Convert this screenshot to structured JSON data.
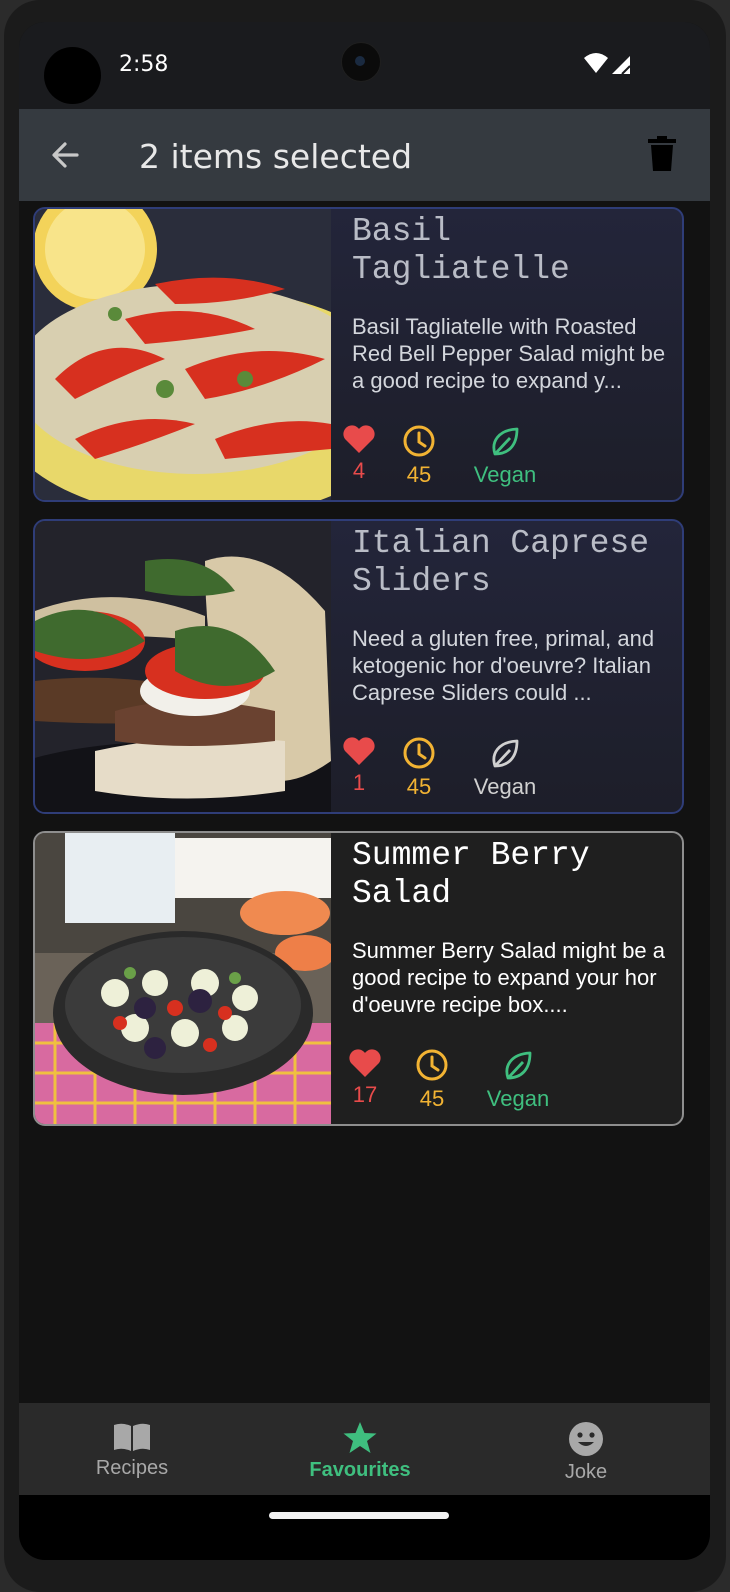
{
  "status_bar": {
    "time": "2:58"
  },
  "app_bar": {
    "title": "2 items selected",
    "back_icon": "arrow-left-icon",
    "delete_icon": "trash-icon"
  },
  "recipes": [
    {
      "title": "Basil Tagliatelle",
      "description": "Basil Tagliatelle with Roasted Red Bell Pepper Salad might be a good recipe to expand y...",
      "likes": "4",
      "minutes": "45",
      "diet": "Vegan",
      "selected": true,
      "vegan_color": "#3fbf7f"
    },
    {
      "title": "Italian Caprese Sliders",
      "description": "Need a gluten free, primal, and ketogenic hor d'oeuvre? Italian Caprese Sliders could ...",
      "likes": "1",
      "minutes": "45",
      "diet": "Vegan",
      "selected": true,
      "vegan_color": "#d0d0d0"
    },
    {
      "title": "Summer Berry Salad",
      "description": "Summer Berry Salad might be a good recipe to expand your hor d'oeuvre recipe box....",
      "likes": "17",
      "minutes": "45",
      "diet": "Vegan",
      "selected": false,
      "vegan_color": "#3fbf7f"
    }
  ],
  "bottom_nav": {
    "items": [
      {
        "label": "Recipes",
        "icon": "book-icon",
        "active": false
      },
      {
        "label": "Favourites",
        "icon": "star-icon",
        "active": true
      },
      {
        "label": "Joke",
        "icon": "smiley-icon",
        "active": false
      }
    ]
  },
  "colors": {
    "like": "#e84b4b",
    "time": "#f2b333",
    "vegan": "#3fbf7f",
    "active_nav": "#3fbf7f",
    "selected_border": "#2f3d78"
  }
}
